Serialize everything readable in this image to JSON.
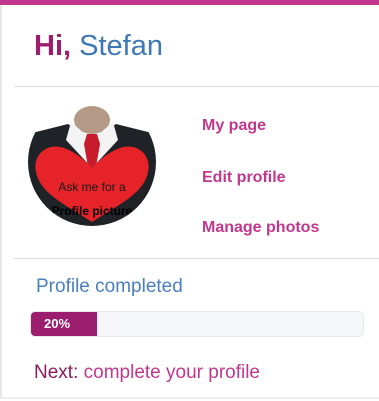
{
  "header": {
    "greeting_prefix": "Hi,",
    "user_name": "Stefan"
  },
  "avatar": {
    "line1": "Ask me for a",
    "line2": "Profile picture"
  },
  "menu": {
    "items": [
      {
        "label": "My page"
      },
      {
        "label": "Edit profile"
      },
      {
        "label": "Manage photos"
      }
    ]
  },
  "profile_progress": {
    "label": "Profile completed",
    "value_text": "20%",
    "fraction": 0.2
  },
  "next_step": {
    "prefix": "Next:",
    "link": "complete your profile"
  },
  "colors": {
    "accent": "#c2378e",
    "brand_dark": "#9b1f6e",
    "blue": "#3f79b5"
  }
}
